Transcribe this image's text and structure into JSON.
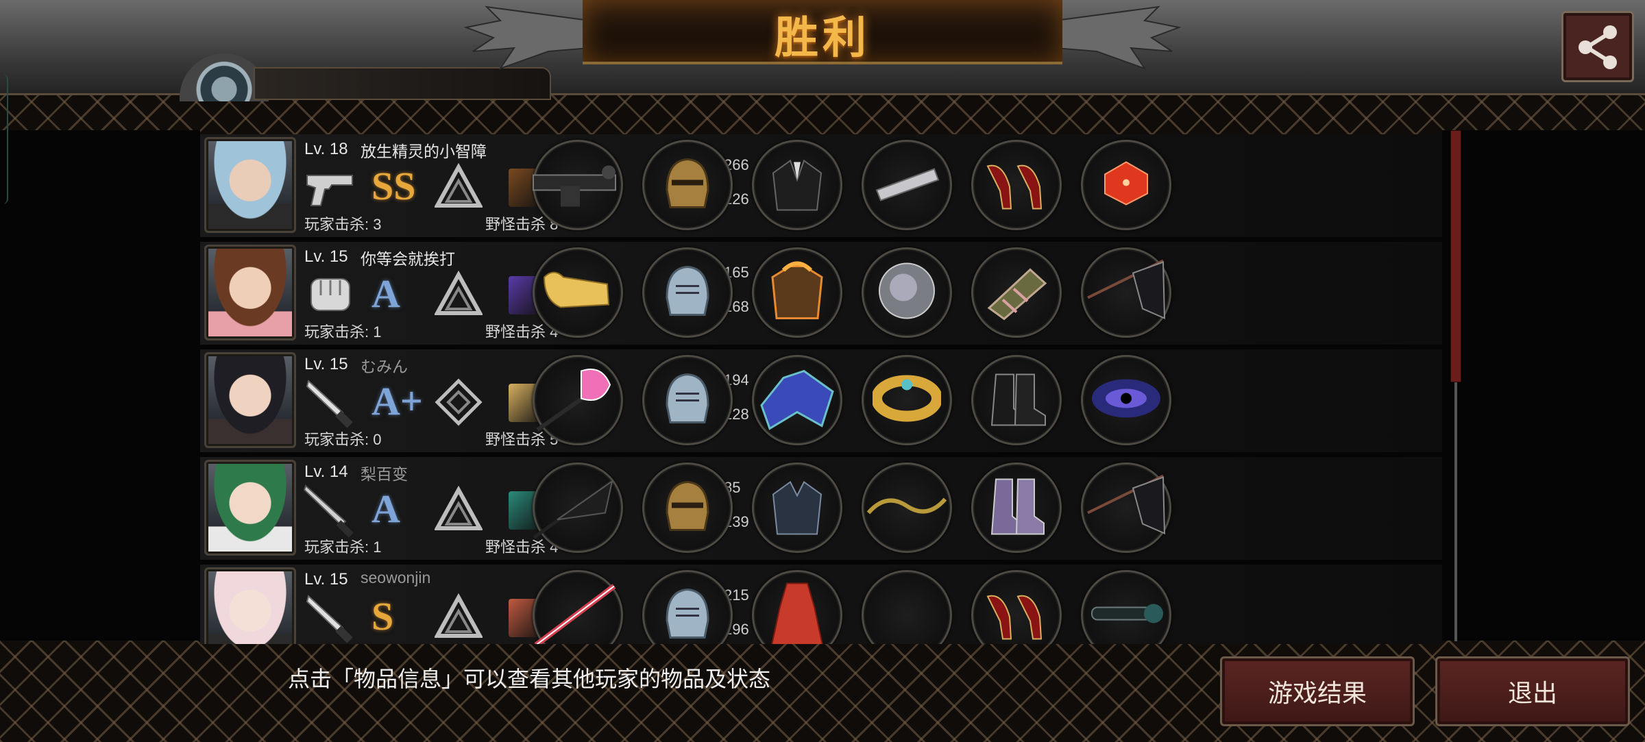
{
  "header": {
    "title": "胜利"
  },
  "players": [
    {
      "level": "Lv. 18",
      "name": "放生精灵的小智障",
      "name_dim": false,
      "weapon_icon": "pistol-icon",
      "rank": "SS",
      "rank_color": "gold",
      "player_kills": "玩家击杀: 3",
      "monster_kills": "野怪击杀 8",
      "attack": "266",
      "defense": "226",
      "hair": "#9fc3d8",
      "skin": "#e9cdb8",
      "outfit": "#2a2a2a",
      "items": [
        "grenade-launcher-icon",
        "knight-helmet-icon",
        "suit-jacket-icon",
        "bracer-icon",
        "red-heels-icon",
        "dice-icon"
      ]
    },
    {
      "level": "Lv. 15",
      "name": "你等会就挨打",
      "name_dim": false,
      "weapon_icon": "fist-icon",
      "rank": "A",
      "rank_color": "blue",
      "player_kills": "玩家击杀: 1",
      "monster_kills": "野怪击杀 4",
      "attack": "165",
      "defense": "268",
      "hair": "#6a3a22",
      "skin": "#f0cfb8",
      "outfit": "#e8a0a8",
      "items": [
        "golden-gauntlet-icon",
        "silver-helmet-icon",
        "flaming-armor-icon",
        "shield-disc-icon",
        "bandaged-arm-icon",
        "black-flag-icon"
      ]
    },
    {
      "level": "Lv. 15",
      "name": "むみん",
      "name_dim": true,
      "weapon_icon": "knife-icon",
      "rank": "A+",
      "rank_color": "blue",
      "player_kills": "玩家击杀: 0",
      "monster_kills": "野怪击杀 5",
      "attack": "194",
      "defense": "228",
      "hair": "#1e1e24",
      "skin": "#efd2c0",
      "outfit": "#3a3030",
      "items": [
        "pink-axe-icon",
        "silver-helmet-icon",
        "blue-cape-icon",
        "gold-bracelet-icon",
        "combat-boots-icon",
        "galaxy-orb-icon"
      ]
    },
    {
      "level": "Lv. 14",
      "name": "梨百变",
      "name_dim": true,
      "weapon_icon": "blade-icon",
      "rank": "A",
      "rank_color": "blue",
      "player_kills": "玩家击杀: 1",
      "monster_kills": "野怪击杀 4",
      "attack": "85",
      "defense": "239",
      "hair": "#2f7a4a",
      "skin": "#f2d8c6",
      "outfit": "#e8e8e8",
      "items": [
        "umbrella-icon",
        "knight-helmet-icon",
        "leather-jacket-icon",
        "vine-whip-icon",
        "purple-boots-icon",
        "black-flag-icon"
      ]
    },
    {
      "level": "Lv. 15",
      "name": "seowonjin",
      "name_dim": true,
      "weapon_icon": "knife-icon",
      "rank": "S",
      "rank_color": "gold",
      "player_kills": "",
      "monster_kills": "",
      "attack": "215",
      "defense": "196",
      "hair": "#f0d8dc",
      "skin": "#f5e0d8",
      "outfit": "#2a2a2a",
      "items": [
        "red-sword-icon",
        "silver-helmet-icon",
        "red-dress-icon",
        "",
        "red-heels-icon",
        "scope-icon"
      ]
    }
  ],
  "footer": {
    "hint": "点击「物品信息」可以查看其他玩家的物品及状态",
    "result_button": "游戏结果",
    "exit_button": "退出"
  },
  "colors": {
    "accent": "#f4b84a",
    "button": "#5a2522",
    "rank_gold": "#e7a73a",
    "rank_blue": "#7ea4d8"
  }
}
